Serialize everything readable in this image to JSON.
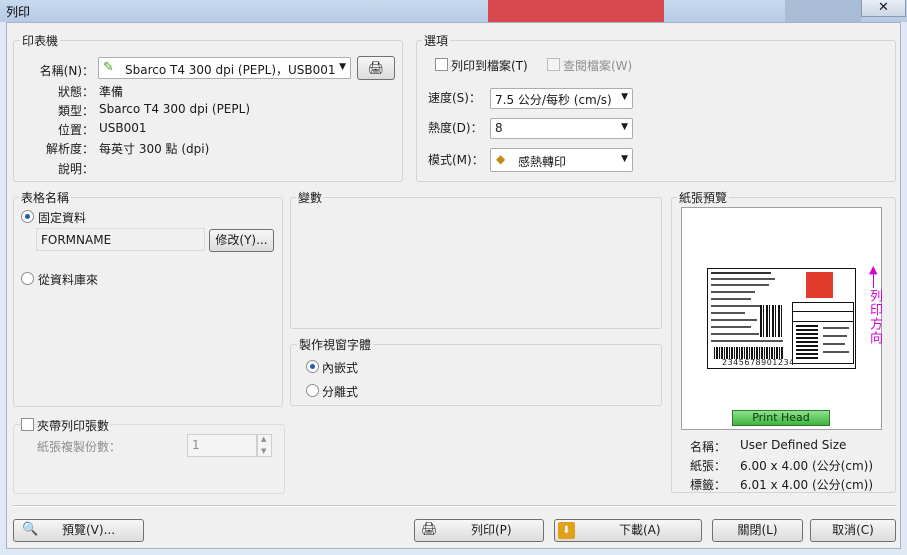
{
  "window": {
    "title": "列印",
    "close_glyph": "✕"
  },
  "printer": {
    "group_title": "印表機",
    "name_label": "名稱(N)：",
    "name_value": "Sbarco T4 300 dpi (PEPL)，USB001",
    "status_label": "狀態：",
    "status_value": "準備",
    "type_label": "類型：",
    "type_value": "Sbarco T4 300 dpi (PEPL)",
    "location_label": "位置：",
    "location_value": "USB001",
    "resolution_label": "解析度：",
    "resolution_value": "每英寸 300 點 (dpi)",
    "comment_label": "說明："
  },
  "options": {
    "group_title": "選項",
    "print_to_file": "列印到檔案(T)",
    "query_file": "查閱檔案(W)",
    "speed_label": "速度(S)：",
    "speed_value": "7.5  公分/每秒 (cm/s)",
    "darkness_label": "熱度(D)：",
    "darkness_value": "8",
    "mode_label": "模式(M)：",
    "mode_value": "感熱轉印"
  },
  "form": {
    "group_title": "表格名稱",
    "fixed_data": "固定資料",
    "form_name": "FORMNAME",
    "modify_button": "修改(Y)...",
    "from_database": "從資料庫來"
  },
  "variables": {
    "group_title": "變數"
  },
  "font_mode": {
    "group_title": "製作視窗字體",
    "embedded": "內嵌式",
    "separate": "分離式"
  },
  "copies": {
    "checkbox_label": "夾帶列印張數",
    "copies_label": "紙張複製份數：",
    "copies_value": "1"
  },
  "paper_preview": {
    "group_title": "紙張預覽",
    "print_head": "Print Head",
    "print_direction": "列印方向",
    "name_label": "名稱：",
    "name_value": "User Defined Size",
    "paper_label": "紙張：",
    "paper_value": "6.00 x 4.00 (公分(cm))",
    "label_label": "標籤：",
    "label_value": "6.01 x 4.00 (公分(cm))",
    "label_barcode_text": "2345678901234"
  },
  "buttons": {
    "preview": "預覽(V)...",
    "print": "列印(P)",
    "download": "下載(A)",
    "close": "關閉(L)",
    "cancel": "取消(C)"
  },
  "colors": {
    "print_direction": "#d400d4",
    "print_head": "#4cbc4c",
    "download_icon": "#e0a21a"
  }
}
